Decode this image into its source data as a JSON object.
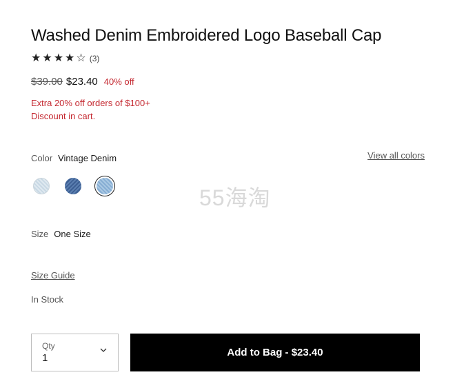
{
  "product": {
    "title": "Washed Denim Embroidered Logo Baseball Cap",
    "rating": {
      "stars": 4,
      "out_of": 5,
      "review_count_text": "(3)"
    },
    "price": {
      "original": "$39.00",
      "sale": "$23.40",
      "discount": "40% off"
    },
    "promo": {
      "line1": "Extra 20% off orders of $100+",
      "line2": "Discount in cart."
    }
  },
  "color": {
    "label": "Color",
    "selected": "Vintage Denim",
    "view_all": "View all colors",
    "swatches": [
      {
        "name": "light-wash",
        "color": "#d5e2eb"
      },
      {
        "name": "dark-wash",
        "color": "#4a6da1"
      },
      {
        "name": "vintage-denim",
        "color": "#9bbddd",
        "selected": true
      }
    ]
  },
  "watermark": "55海淘",
  "size": {
    "label": "Size",
    "value": "One Size",
    "guide": "Size Guide"
  },
  "stock": "In Stock",
  "qty": {
    "label": "Qty",
    "value": "1"
  },
  "add_to_bag": "Add to Bag - $23.40",
  "icons": {
    "star": "star-icon",
    "chevron": "chevron-down-icon"
  }
}
